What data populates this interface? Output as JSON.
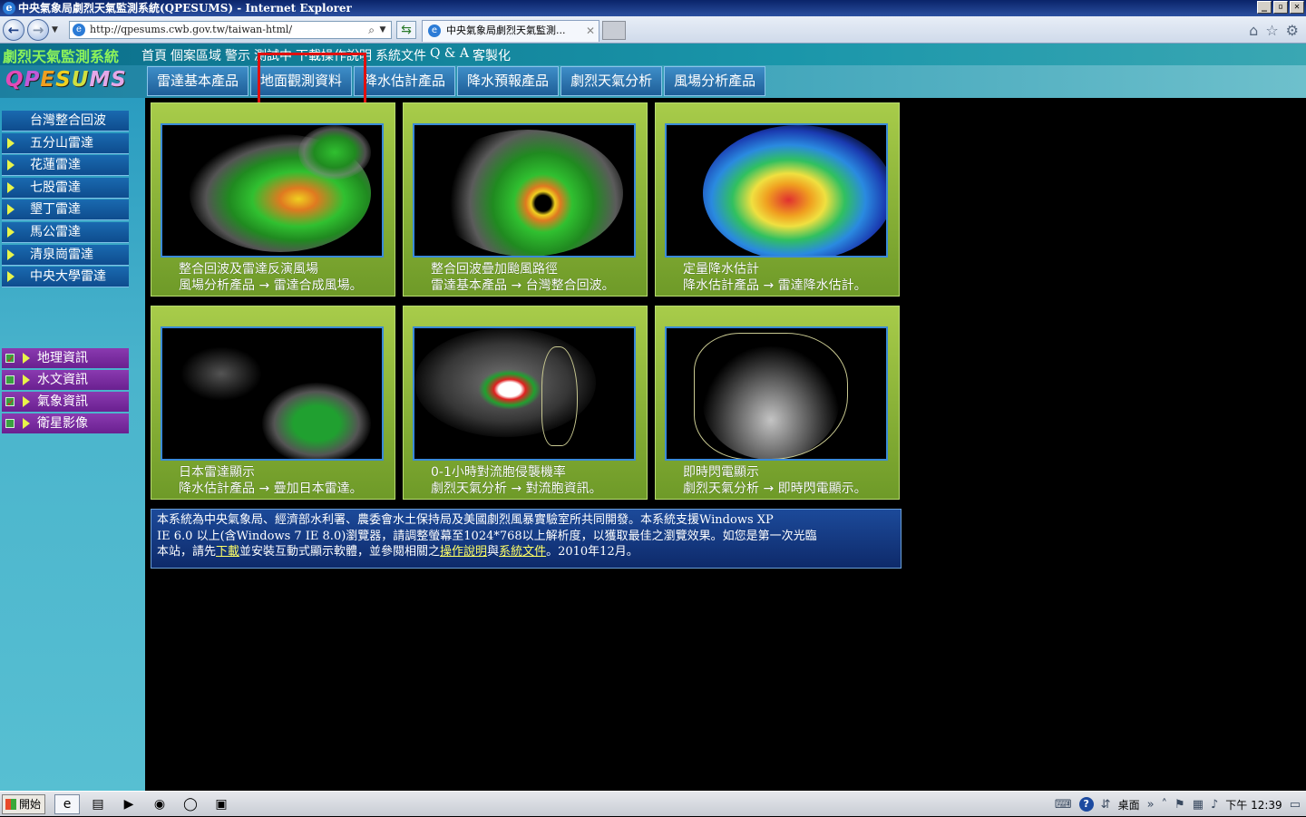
{
  "window": {
    "title": "中央氣象局劇烈天氣監測系統(QPESUMS) - Internet Explorer",
    "address": "http://qpesums.cwb.gov.tw/taiwan-html/",
    "tab_title": "中央氣象局劇烈天氣監測...",
    "min_glyph": "_",
    "max_glyph": "▫",
    "close_glyph": "✕"
  },
  "site": {
    "name": "劇烈天氣監測系統",
    "top_menu": [
      "首頁",
      "個案區域",
      "警示",
      "測試中",
      "下載操作說明",
      "系統文件",
      "Q & A",
      "客製化"
    ],
    "logo": [
      "Q",
      "P",
      "E",
      "S",
      "U",
      "M",
      "S"
    ],
    "product_tabs": [
      "雷達基本產品",
      "地面觀測資料",
      "降水估計產品",
      "降水預報產品",
      "劇烈天氣分析",
      "風場分析產品"
    ],
    "highlighted_tab": "地面觀測資料"
  },
  "sidebar": {
    "radars": [
      "台灣整合回波",
      "五分山雷達",
      "花蓮雷達",
      "七股雷達",
      "墾丁雷達",
      "馬公雷達",
      "清泉崗雷達",
      "中央大學雷達"
    ],
    "layers": [
      {
        "label": "地理資訊",
        "checked": true
      },
      {
        "label": "水文資訊",
        "checked": false
      },
      {
        "label": "氣象資訊",
        "checked": true
      },
      {
        "label": "衛星影像",
        "checked": false
      }
    ]
  },
  "cards": [
    {
      "line1": "整合回波及雷達反演風場",
      "line2": "風場分析產品 → 雷達合成風場。"
    },
    {
      "line1": "整合回波疊加颱風路徑",
      "line2": "雷達基本產品 → 台灣整合回波。"
    },
    {
      "line1": "定量降水估計",
      "line2": "降水估計產品 → 雷達降水估計。"
    },
    {
      "line1": "日本雷達顯示",
      "line2": "降水估計產品 → 疊加日本雷達。"
    },
    {
      "line1": "0-1小時對流胞侵襲機率",
      "line2": "劇烈天氣分析 → 對流胞資訊。"
    },
    {
      "line1": "即時閃電顯示",
      "line2": "劇烈天氣分析 → 即時閃電顯示。"
    }
  ],
  "info": {
    "p1": "本系統為中央氣象局、經濟部水利署、農委會水土保持局及美國劇烈風暴實驗室所共同開發。本系統支援Windows XP",
    "p2": "IE 6.0 以上(含Windows 7 IE 8.0)瀏覽器，請調整螢幕至1024*768以上解析度，以獲取最佳之瀏覽效果。如您是第一次光臨",
    "p3a": "本站，請先",
    "link_download": "下載",
    "p3b": "並安裝互動式顯示軟體，並參閱相關之",
    "link_manual": "操作說明",
    "p3c": "與",
    "link_docs": "系統文件",
    "p3d": "。2010年12月。"
  },
  "taskbar": {
    "start": "開始",
    "desktop": "桌面",
    "clock": "下午 12:39"
  },
  "colors": {
    "highlight": "#e01010",
    "sitename": "#8cf25a",
    "link": "#ffff66"
  }
}
